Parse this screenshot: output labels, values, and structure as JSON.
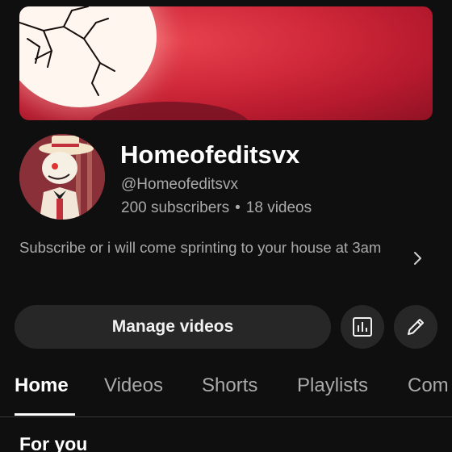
{
  "channel": {
    "name": "Homeofeditsvx",
    "handle": "@Homeofeditsvx",
    "subscribers": "200 subscribers",
    "separator": "•",
    "videos": "18 videos",
    "description": "Subscribe or i will come sprinting to your house at 3am"
  },
  "actions": {
    "manage_label": "Manage videos"
  },
  "tabs": [
    {
      "label": "Home",
      "active": true
    },
    {
      "label": "Videos",
      "active": false
    },
    {
      "label": "Shorts",
      "active": false
    },
    {
      "label": "Playlists",
      "active": false
    },
    {
      "label": "Com",
      "active": false
    }
  ],
  "section": {
    "title": "For you"
  },
  "icons": {
    "description": "chevron-right-icon",
    "analytics": "analytics-icon",
    "edit": "pencil-icon"
  },
  "colors": {
    "background": "#0f0f0f",
    "button": "#272727",
    "muted_text": "#aaaaaa",
    "banner_red": "#d12a3b"
  }
}
